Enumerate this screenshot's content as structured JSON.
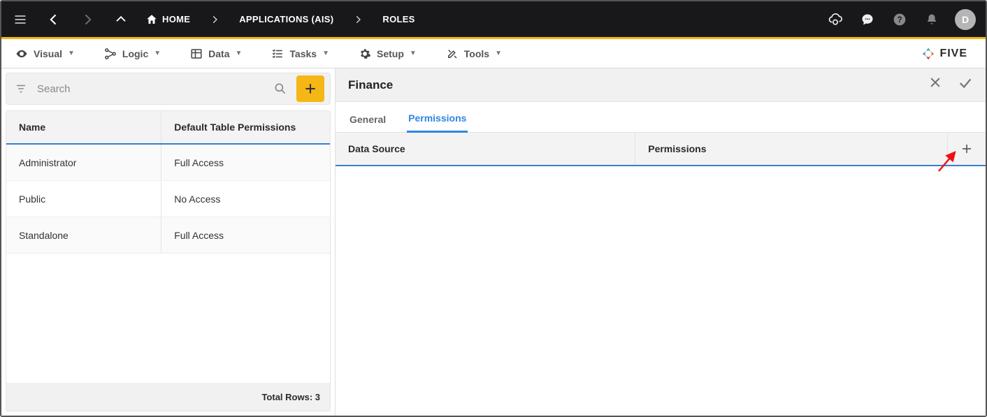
{
  "header": {
    "breadcrumbs": [
      "HOME",
      "APPLICATIONS (AIS)",
      "ROLES"
    ],
    "avatar_initial": "D"
  },
  "toolbar": {
    "items": [
      {
        "label": "Visual",
        "icon": "eye"
      },
      {
        "label": "Logic",
        "icon": "logic"
      },
      {
        "label": "Data",
        "icon": "data"
      },
      {
        "label": "Tasks",
        "icon": "tasks"
      },
      {
        "label": "Setup",
        "icon": "gear"
      },
      {
        "label": "Tools",
        "icon": "tools"
      }
    ],
    "brand": "FIVE"
  },
  "search": {
    "placeholder": "Search"
  },
  "table": {
    "columns": [
      "Name",
      "Default Table Permissions"
    ],
    "rows": [
      {
        "name": "Administrator",
        "perm": "Full Access"
      },
      {
        "name": "Public",
        "perm": "No Access"
      },
      {
        "name": "Standalone",
        "perm": "Full Access"
      }
    ],
    "footer": "Total Rows: 3"
  },
  "detail": {
    "title": "Finance",
    "tabs": [
      "General",
      "Permissions"
    ],
    "active_tab": 1,
    "sub_columns": [
      "Data Source",
      "Permissions"
    ]
  },
  "colors": {
    "accent": "#f5b715",
    "link": "#2f86e2"
  }
}
